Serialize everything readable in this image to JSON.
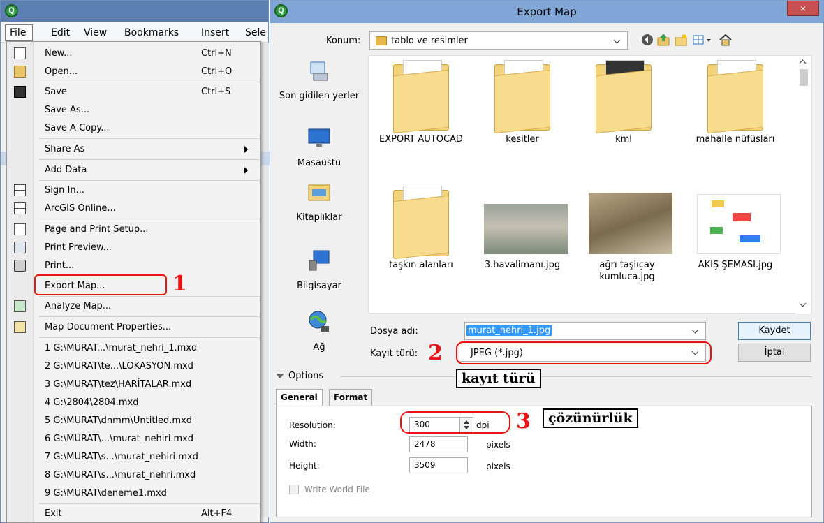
{
  "app": {
    "menu": [
      "File",
      "Edit",
      "View",
      "Bookmarks",
      "Insert",
      "Sele"
    ],
    "file_menu": [
      {
        "label": "New...",
        "shortcut": "Ctrl+N",
        "icon": "new-document-icon"
      },
      {
        "label": "Open...",
        "shortcut": "Ctrl+O",
        "icon": "open-folder-icon"
      },
      {
        "label": "Save",
        "shortcut": "Ctrl+S",
        "icon": "save-disk-icon"
      },
      {
        "label": "Save As...",
        "shortcut": "",
        "icon": ""
      },
      {
        "label": "Save A Copy...",
        "shortcut": "",
        "icon": ""
      },
      {
        "label": "Share As",
        "shortcut": "",
        "icon": "",
        "submenu": true
      },
      {
        "label": "Add Data",
        "shortcut": "",
        "icon": "",
        "submenu": true
      },
      {
        "label": "Sign In...",
        "shortcut": "",
        "icon": "sign-in-icon"
      },
      {
        "label": "ArcGIS Online...",
        "shortcut": "",
        "icon": "arcgis-online-icon"
      },
      {
        "label": "Page and Print Setup...",
        "shortcut": "",
        "icon": "page-setup-icon"
      },
      {
        "label": "Print Preview...",
        "shortcut": "",
        "icon": "print-preview-icon"
      },
      {
        "label": "Print...",
        "shortcut": "",
        "icon": "printer-icon"
      },
      {
        "label": "Export Map...",
        "shortcut": "",
        "icon": ""
      },
      {
        "label": "Analyze Map...",
        "shortcut": "",
        "icon": "analyze-map-icon"
      },
      {
        "label": "Map Document Properties...",
        "shortcut": "",
        "icon": "document-properties-icon"
      },
      {
        "label": "1 G:\\MURAT...\\murat_nehri_1.mxd",
        "shortcut": "",
        "icon": ""
      },
      {
        "label": "2 G:\\MURAT\\te...\\LOKASYON.mxd",
        "shortcut": "",
        "icon": ""
      },
      {
        "label": "3 G:\\MURAT\\tez\\HARİTALAR.mxd",
        "shortcut": "",
        "icon": ""
      },
      {
        "label": "4 G:\\2804\\2804.mxd",
        "shortcut": "",
        "icon": ""
      },
      {
        "label": "5 G:\\MURAT\\dnmm\\Untitled.mxd",
        "shortcut": "",
        "icon": ""
      },
      {
        "label": "6 G:\\MURAT\\...\\murat_nehiri.mxd",
        "shortcut": "",
        "icon": ""
      },
      {
        "label": "7 G:\\MURAT\\s...\\murat_nehiri.mxd",
        "shortcut": "",
        "icon": ""
      },
      {
        "label": "8 G:\\MURAT\\s...\\murat_nehri.mxd",
        "shortcut": "",
        "icon": ""
      },
      {
        "label": "9 G:\\MURAT\\deneme1.mxd",
        "shortcut": "",
        "icon": ""
      },
      {
        "label": "Exit",
        "shortcut": "Alt+F4",
        "icon": ""
      }
    ]
  },
  "dialog": {
    "title": "Export Map",
    "close": "×",
    "location_label": "Konum:",
    "location_value": "tablo ve resimler",
    "places": [
      "Son gidilen yerler",
      "Masaüstü",
      "Kitaplıklar",
      "Bilgisayar",
      "Ağ"
    ],
    "files": [
      {
        "name": "EXPORT AUTOCAD",
        "kind": "folder"
      },
      {
        "name": "kesitler",
        "kind": "folder"
      },
      {
        "name": "kml",
        "kind": "folder"
      },
      {
        "name": "mahalle nüfüsları",
        "kind": "folder"
      },
      {
        "name": "taşkın alanları",
        "kind": "folder"
      },
      {
        "name": "3.havalimanı.jpg",
        "kind": "photo"
      },
      {
        "name": "ağrı taşlıçay kumluca.jpg",
        "kind": "photo"
      },
      {
        "name": "AKIŞ ŞEMASI.jpg",
        "kind": "photo"
      }
    ],
    "filename_label": "Dosya adı:",
    "filename_value": "murat_nehri_1.jpg",
    "filetype_label": "Kayıt türü:",
    "filetype_value": "JPEG (*.jpg)",
    "save_button": "Kaydet",
    "cancel_button": "İptal",
    "options_label": "Options",
    "tabs": [
      "General",
      "Format"
    ],
    "resolution_label": "Resolution:",
    "resolution_value": "300",
    "resolution_unit": "dpi",
    "width_label": "Width:",
    "width_value": "2478",
    "width_unit": "pixels",
    "height_label": "Height:",
    "height_value": "3509",
    "height_unit": "pixels",
    "world_file_label": "Write World File"
  },
  "annotations": {
    "step1": "1",
    "step2": "2",
    "step3": "3",
    "label_type": "kayıt türü",
    "label_resolution": "çözünürlük"
  }
}
